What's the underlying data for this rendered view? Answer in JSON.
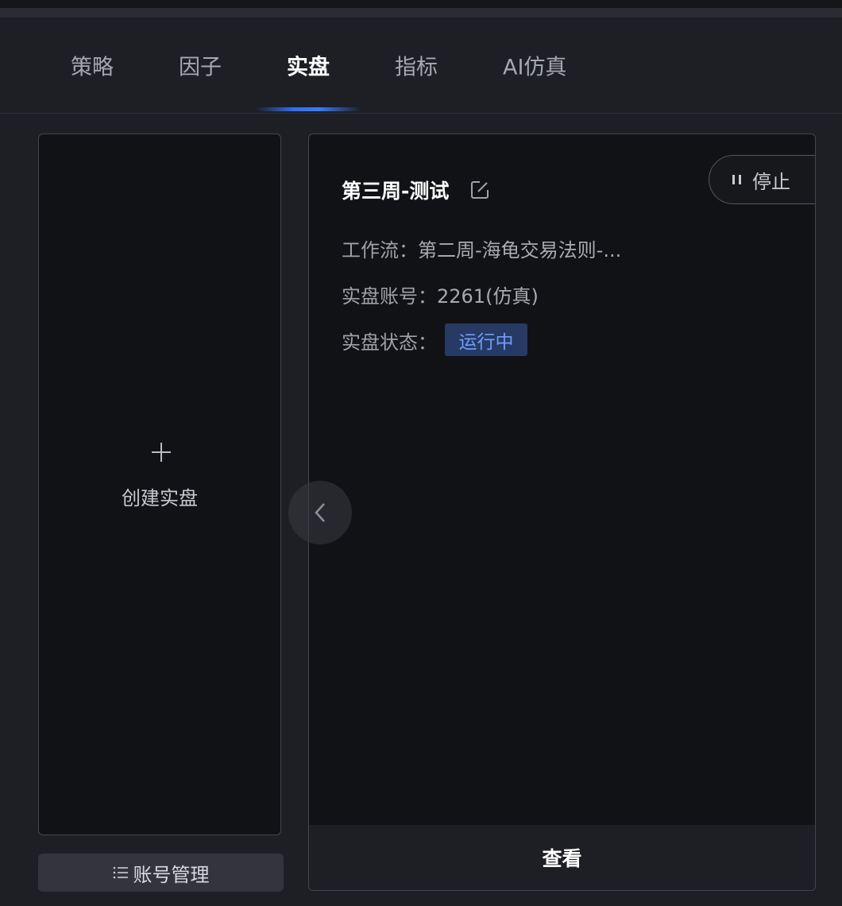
{
  "tabs": [
    {
      "label": "策略",
      "active": false
    },
    {
      "label": "因子",
      "active": false
    },
    {
      "label": "实盘",
      "active": true
    },
    {
      "label": "指标",
      "active": false
    },
    {
      "label": "AI仿真",
      "active": false
    }
  ],
  "create_card": {
    "icon": "plus-icon",
    "label": "创建实盘"
  },
  "account_button": {
    "icon": "list-icon",
    "label": "账号管理"
  },
  "live_card": {
    "title": "第三周-测试",
    "edit_icon": "edit-icon",
    "stop_button": {
      "icon": "pause-icon",
      "label": "停止"
    },
    "workflow_label": "工作流：",
    "workflow_value": "第二周-海龟交易法则-...",
    "account_label": "实盘账号：",
    "account_value": "2261(仿真)",
    "status_label": "实盘状态：",
    "status_value": "运行中",
    "view_label": "查看"
  },
  "prev_icon": "chevron-left-icon",
  "colors": {
    "background": "#1e1f24",
    "card": "#111215",
    "accent": "#3a7bff",
    "status_badge_bg": "#273a63",
    "status_badge_text": "#6f9cff"
  }
}
